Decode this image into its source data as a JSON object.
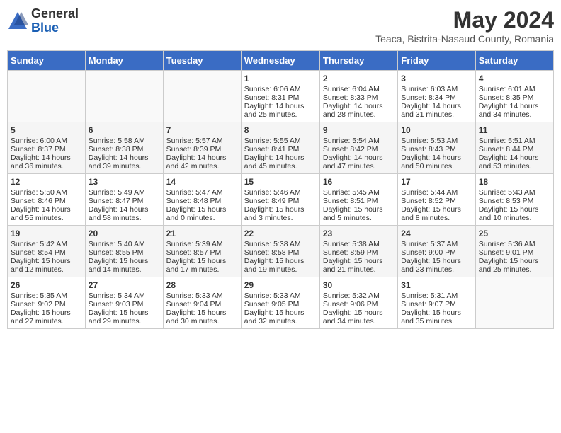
{
  "logo": {
    "general": "General",
    "blue": "Blue"
  },
  "title": "May 2024",
  "subtitle": "Teaca, Bistrita-Nasaud County, Romania",
  "headers": [
    "Sunday",
    "Monday",
    "Tuesday",
    "Wednesday",
    "Thursday",
    "Friday",
    "Saturday"
  ],
  "weeks": [
    [
      {
        "day": "",
        "content": ""
      },
      {
        "day": "",
        "content": ""
      },
      {
        "day": "",
        "content": ""
      },
      {
        "day": "1",
        "content": "Sunrise: 6:06 AM\nSunset: 8:31 PM\nDaylight: 14 hours and 25 minutes."
      },
      {
        "day": "2",
        "content": "Sunrise: 6:04 AM\nSunset: 8:33 PM\nDaylight: 14 hours and 28 minutes."
      },
      {
        "day": "3",
        "content": "Sunrise: 6:03 AM\nSunset: 8:34 PM\nDaylight: 14 hours and 31 minutes."
      },
      {
        "day": "4",
        "content": "Sunrise: 6:01 AM\nSunset: 8:35 PM\nDaylight: 14 hours and 34 minutes."
      }
    ],
    [
      {
        "day": "5",
        "content": "Sunrise: 6:00 AM\nSunset: 8:37 PM\nDaylight: 14 hours and 36 minutes."
      },
      {
        "day": "6",
        "content": "Sunrise: 5:58 AM\nSunset: 8:38 PM\nDaylight: 14 hours and 39 minutes."
      },
      {
        "day": "7",
        "content": "Sunrise: 5:57 AM\nSunset: 8:39 PM\nDaylight: 14 hours and 42 minutes."
      },
      {
        "day": "8",
        "content": "Sunrise: 5:55 AM\nSunset: 8:41 PM\nDaylight: 14 hours and 45 minutes."
      },
      {
        "day": "9",
        "content": "Sunrise: 5:54 AM\nSunset: 8:42 PM\nDaylight: 14 hours and 47 minutes."
      },
      {
        "day": "10",
        "content": "Sunrise: 5:53 AM\nSunset: 8:43 PM\nDaylight: 14 hours and 50 minutes."
      },
      {
        "day": "11",
        "content": "Sunrise: 5:51 AM\nSunset: 8:44 PM\nDaylight: 14 hours and 53 minutes."
      }
    ],
    [
      {
        "day": "12",
        "content": "Sunrise: 5:50 AM\nSunset: 8:46 PM\nDaylight: 14 hours and 55 minutes."
      },
      {
        "day": "13",
        "content": "Sunrise: 5:49 AM\nSunset: 8:47 PM\nDaylight: 14 hours and 58 minutes."
      },
      {
        "day": "14",
        "content": "Sunrise: 5:47 AM\nSunset: 8:48 PM\nDaylight: 15 hours and 0 minutes."
      },
      {
        "day": "15",
        "content": "Sunrise: 5:46 AM\nSunset: 8:49 PM\nDaylight: 15 hours and 3 minutes."
      },
      {
        "day": "16",
        "content": "Sunrise: 5:45 AM\nSunset: 8:51 PM\nDaylight: 15 hours and 5 minutes."
      },
      {
        "day": "17",
        "content": "Sunrise: 5:44 AM\nSunset: 8:52 PM\nDaylight: 15 hours and 8 minutes."
      },
      {
        "day": "18",
        "content": "Sunrise: 5:43 AM\nSunset: 8:53 PM\nDaylight: 15 hours and 10 minutes."
      }
    ],
    [
      {
        "day": "19",
        "content": "Sunrise: 5:42 AM\nSunset: 8:54 PM\nDaylight: 15 hours and 12 minutes."
      },
      {
        "day": "20",
        "content": "Sunrise: 5:40 AM\nSunset: 8:55 PM\nDaylight: 15 hours and 14 minutes."
      },
      {
        "day": "21",
        "content": "Sunrise: 5:39 AM\nSunset: 8:57 PM\nDaylight: 15 hours and 17 minutes."
      },
      {
        "day": "22",
        "content": "Sunrise: 5:38 AM\nSunset: 8:58 PM\nDaylight: 15 hours and 19 minutes."
      },
      {
        "day": "23",
        "content": "Sunrise: 5:38 AM\nSunset: 8:59 PM\nDaylight: 15 hours and 21 minutes."
      },
      {
        "day": "24",
        "content": "Sunrise: 5:37 AM\nSunset: 9:00 PM\nDaylight: 15 hours and 23 minutes."
      },
      {
        "day": "25",
        "content": "Sunrise: 5:36 AM\nSunset: 9:01 PM\nDaylight: 15 hours and 25 minutes."
      }
    ],
    [
      {
        "day": "26",
        "content": "Sunrise: 5:35 AM\nSunset: 9:02 PM\nDaylight: 15 hours and 27 minutes."
      },
      {
        "day": "27",
        "content": "Sunrise: 5:34 AM\nSunset: 9:03 PM\nDaylight: 15 hours and 29 minutes."
      },
      {
        "day": "28",
        "content": "Sunrise: 5:33 AM\nSunset: 9:04 PM\nDaylight: 15 hours and 30 minutes."
      },
      {
        "day": "29",
        "content": "Sunrise: 5:33 AM\nSunset: 9:05 PM\nDaylight: 15 hours and 32 minutes."
      },
      {
        "day": "30",
        "content": "Sunrise: 5:32 AM\nSunset: 9:06 PM\nDaylight: 15 hours and 34 minutes."
      },
      {
        "day": "31",
        "content": "Sunrise: 5:31 AM\nSunset: 9:07 PM\nDaylight: 15 hours and 35 minutes."
      },
      {
        "day": "",
        "content": ""
      }
    ]
  ]
}
